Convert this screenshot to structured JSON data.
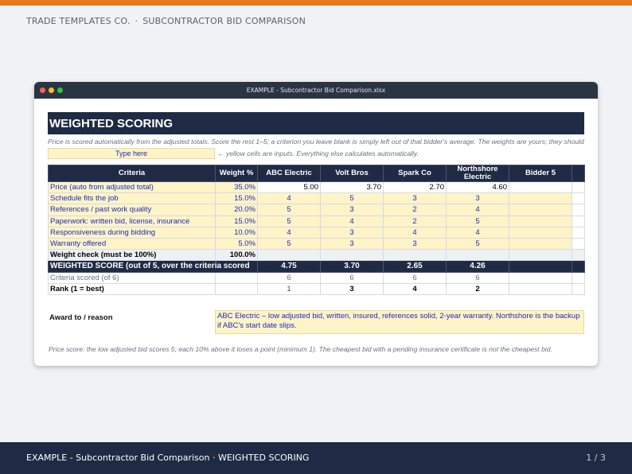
{
  "header": {
    "brand": "TRADE TEMPLATES CO.",
    "separator": "·",
    "subtitle": "SUBCONTRACTOR BID COMPARISON",
    "accent": "#e8781f"
  },
  "window": {
    "title": "EXAMPLE - Subcontractor Bid Comparison.xlsx"
  },
  "sheet": {
    "banner": "WEIGHTED SCORING",
    "note": "Price is scored automatically from the adjusted totals. Score the rest 1–5; a criterion you leave blank is simply left out of that bidder's average. The weights are yours; they should",
    "input_sample": "Type here",
    "input_legend": "← yellow cells are inputs. Everything else calculates automatically.",
    "columns": [
      "Criteria",
      "Weight %",
      "ABC Electric",
      "Volt Bros",
      "Spark Co",
      "Northshore Electric",
      "Bidder 5"
    ],
    "criteria": [
      {
        "label": "Price (auto from adjusted total)",
        "weight": "35.0%",
        "scores": [
          "5.00",
          "3.70",
          "2.70",
          "4.60",
          ""
        ]
      },
      {
        "label": "Schedule fits the job",
        "weight": "15.0%",
        "scores": [
          "4",
          "5",
          "3",
          "3",
          ""
        ]
      },
      {
        "label": "References / past work quality",
        "weight": "20.0%",
        "scores": [
          "5",
          "3",
          "2",
          "4",
          ""
        ]
      },
      {
        "label": "Paperwork: written bid, license, insurance",
        "weight": "15.0%",
        "scores": [
          "5",
          "4",
          "2",
          "5",
          ""
        ]
      },
      {
        "label": "Responsiveness during bidding",
        "weight": "10.0%",
        "scores": [
          "4",
          "3",
          "4",
          "4",
          ""
        ]
      },
      {
        "label": "Warranty offered",
        "weight": "5.0%",
        "scores": [
          "5",
          "3",
          "3",
          "5",
          ""
        ]
      }
    ],
    "weight_check": {
      "label": "Weight check (must be 100%)",
      "value": "100.0%"
    },
    "weighted": {
      "label": "WEIGHTED SCORE (out of 5, over the criteria scored",
      "values": [
        "4.75",
        "3.70",
        "2.65",
        "4.26",
        ""
      ]
    },
    "scored": {
      "label": "Criteria scored (of 6)",
      "values": [
        "6",
        "6",
        "6",
        "6",
        ""
      ]
    },
    "rank": {
      "label": "Rank (1 = best)",
      "values": [
        "1",
        "3",
        "4",
        "2",
        ""
      ]
    },
    "award": {
      "label": "Award to / reason",
      "text": "ABC Electric – low adjusted bid, written, insured, references solid, 2-year warranty. Northshore is the backup if ABC's start date slips."
    },
    "footnote": "Price score: the low adjusted bid scores 5; each 10% above it loses a point (minimum 1). The cheapest bid with a pending insurance certificate is not the cheapest bid."
  },
  "footer": {
    "title": "EXAMPLE - Subcontractor Bid Comparison · WEIGHTED SCORING",
    "page": "1 / 3"
  }
}
